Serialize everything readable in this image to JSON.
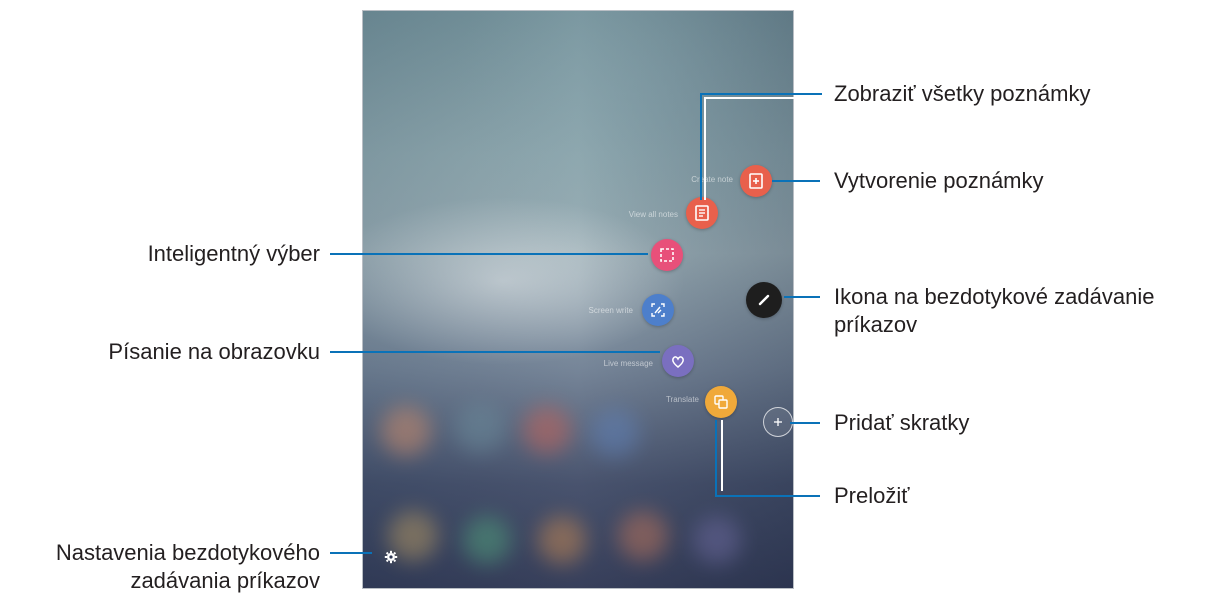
{
  "screen": {
    "menu_labels": {
      "create_note": "Create note",
      "view_all_notes": "View all notes",
      "screen_write": "Screen write",
      "live_message": "Live message",
      "translate": "Translate"
    }
  },
  "callouts": {
    "view_all_notes": "Zobraziť všetky poznámky",
    "create_note": "Vytvorenie poznámky",
    "smart_select": "Inteligentný výber",
    "air_command_icon": "Ikona na bezdotykové zadávanie príkazov",
    "screen_write": "Písanie na obrazovku",
    "add_shortcuts": "Pridať skratky",
    "translate": "Preložiť",
    "settings": "Nastavenia bezdotykového zadávania príkazov"
  },
  "icons": {
    "create_note": "create-note-icon",
    "view_all_notes": "view-all-notes-icon",
    "smart_select": "smart-select-icon",
    "screen_write": "screen-write-icon",
    "live_message": "live-message-icon",
    "translate": "translate-icon",
    "air_command": "pen-icon",
    "add": "plus-icon",
    "settings": "gear-icon"
  },
  "colors": {
    "leader_line": "#0a72b8",
    "note_red": "#e8604c",
    "smart_select_pink": "#e8507a",
    "screen_write_blue": "#4d7fcb",
    "live_message_purple": "#7a6fc0",
    "translate_orange": "#f0a93a",
    "air_command_dark": "#1e1e1e"
  }
}
